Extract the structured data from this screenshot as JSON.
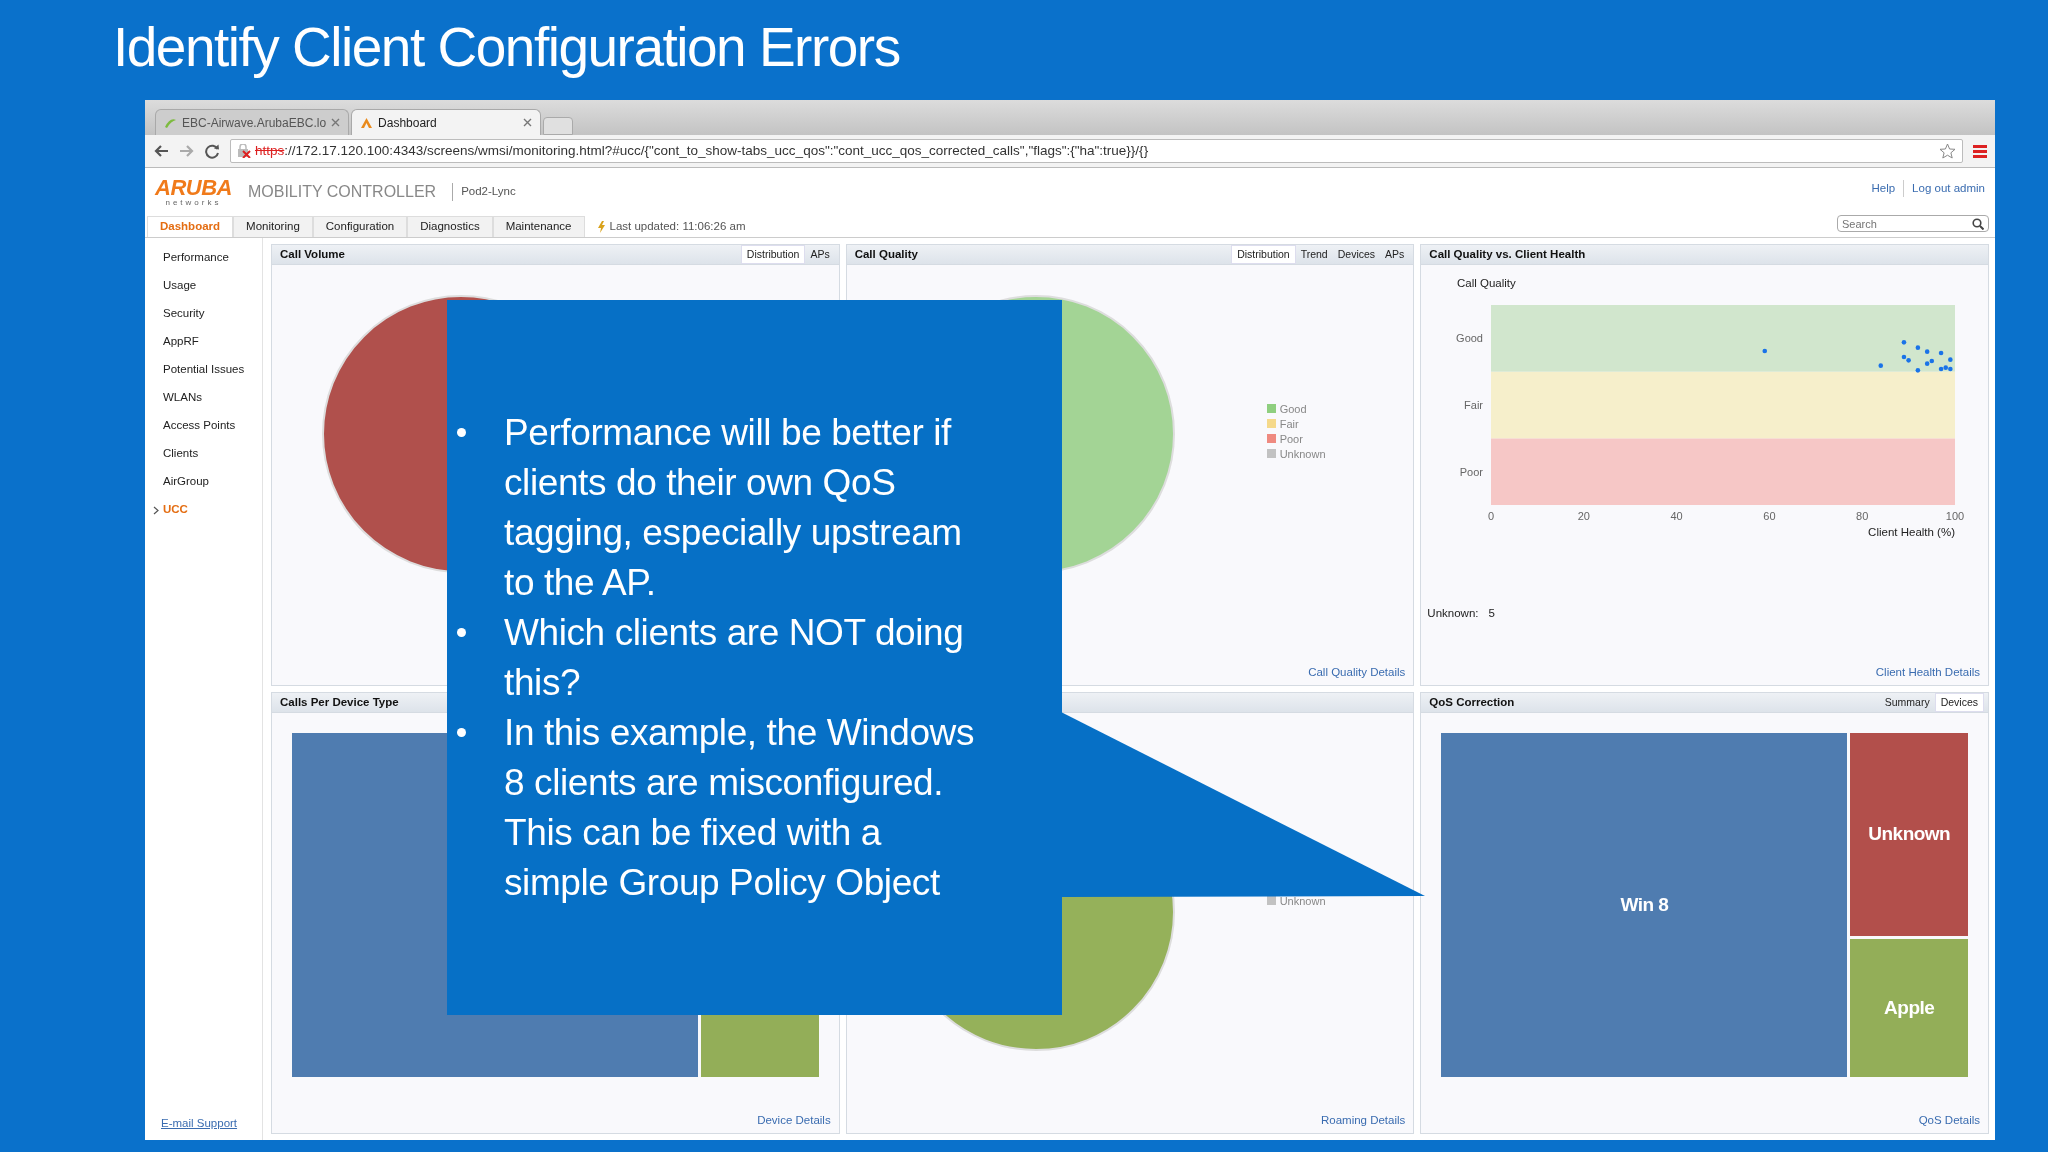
{
  "slide_title": "Identify Client Configuration Errors",
  "browser_tabs": [
    {
      "label": "EBC-Airwave.ArubaEBC.lo",
      "selected": false
    },
    {
      "label": "Dashboard",
      "selected": true
    }
  ],
  "url": {
    "scheme": "https",
    "rest": "://172.17.120.100:4343/screens/wmsi/monitoring.html?#ucc/{\"cont_to_show-tabs_ucc_qos\":\"cont_ucc_qos_corrected_calls\",\"flags\":{\"ha\":true}}/{}"
  },
  "logo": {
    "name": "ARUBA",
    "sub": "networks"
  },
  "product": "MOBILITY CONTROLLER",
  "device": "Pod2-Lync",
  "header_links": [
    "Help",
    "Log out admin"
  ],
  "search": {
    "placeholder": "Search"
  },
  "nav_tabs": [
    {
      "label": "Dashboard",
      "selected": true
    },
    {
      "label": "Monitoring",
      "selected": false
    },
    {
      "label": "Configuration",
      "selected": false
    },
    {
      "label": "Diagnostics",
      "selected": false
    },
    {
      "label": "Maintenance",
      "selected": false
    }
  ],
  "last_updated": "Last updated: 11:06:26 am",
  "sidebar": {
    "items": [
      {
        "label": "Performance",
        "selected": false
      },
      {
        "label": "Usage",
        "selected": false
      },
      {
        "label": "Security",
        "selected": false
      },
      {
        "label": "AppRF",
        "selected": false
      },
      {
        "label": "Potential Issues",
        "selected": false
      },
      {
        "label": "WLANs",
        "selected": false
      },
      {
        "label": "Access Points",
        "selected": false
      },
      {
        "label": "Clients",
        "selected": false
      },
      {
        "label": "AirGroup",
        "selected": false
      },
      {
        "label": "UCC",
        "selected": true
      }
    ],
    "footer_link": "E-mail Support"
  },
  "panels": [
    {
      "kind": "pie",
      "title": "Call Volume",
      "tabs": [
        {
          "label": "Distribution",
          "selected": true
        },
        {
          "label": "APs",
          "selected": false
        }
      ],
      "color": "#b0504c"
    },
    {
      "kind": "pie",
      "title": "Call Quality",
      "tabs": [
        {
          "label": "Distribution",
          "selected": true
        },
        {
          "label": "Trend",
          "selected": false
        },
        {
          "label": "Devices",
          "selected": false
        },
        {
          "label": "APs",
          "selected": false
        }
      ],
      "color": "#a3d495",
      "legend": [
        {
          "label": "Good",
          "color": "#8fcf7f"
        },
        {
          "label": "Fair",
          "color": "#f5d98a"
        },
        {
          "label": "Poor",
          "color": "#ef8a80"
        },
        {
          "label": "Unknown",
          "color": "#c2c2c2"
        }
      ],
      "footer": "Call Quality Details"
    },
    {
      "kind": "scatter",
      "title": "Call Quality vs. Client Health",
      "ylabel": "Call Quality",
      "xlabel": "Client Health (%)",
      "xticks": [
        "0",
        "20",
        "40",
        "60",
        "80",
        "100"
      ],
      "bands": [
        "Good",
        "Fair",
        "Poor"
      ],
      "unknown_label": "Unknown:",
      "unknown_value": "5",
      "footer": "Client Health Details"
    },
    {
      "kind": "treemap",
      "title": "Calls Per Device Type",
      "cells": [
        {
          "color": "#4f7cb0"
        },
        {
          "color": "#93ae58"
        }
      ],
      "footer": "Device Details"
    },
    {
      "kind": "pie",
      "color": "#95b15a",
      "legend": [
        {
          "label": "Unknown",
          "color": "#c2c2c2"
        }
      ],
      "footer": "Roaming Details"
    },
    {
      "kind": "treemap",
      "title": "QoS Correction",
      "tabs": [
        {
          "label": "Summary",
          "selected": false
        },
        {
          "label": "Devices",
          "selected": true
        }
      ],
      "cells": [
        {
          "label": "Win 8",
          "color": "#4f7cb0"
        },
        {
          "label": "Unknown",
          "color": "#b24f4b"
        },
        {
          "label": "Apple",
          "color": "#93ae58"
        }
      ],
      "footer": "QoS Details"
    }
  ],
  "callout": {
    "bullets": [
      "Performance will be better if clients do their own QoS tagging, especially upstream to the AP.",
      "Which clients are NOT doing this?",
      "In this example, the Windows 8 clients are misconfigured. This can be fixed with a simple Group Policy Object"
    ]
  }
}
